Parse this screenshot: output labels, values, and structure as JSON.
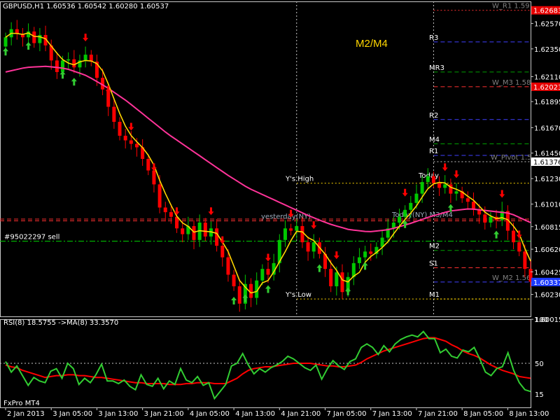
{
  "window": {
    "title_info": "GBPUSD,H1  1.60536  1.60542  1.60280  1.60537",
    "watermark": "FxPro MT4",
    "center_label": "M2/M4"
  },
  "colors": {
    "background": "#000000",
    "grid": "#c8c8c8",
    "bull": "#00c800",
    "bear": "#ff0000",
    "ma_fast": "#ffd700",
    "ma_slow": "#ff3399",
    "rsi": "#32cd32",
    "rsi_ma": "#ff0000",
    "arrow_up": "#32cd32",
    "arrow_down": "#ff0000",
    "current_price_box": "#1e3cff",
    "red_price_box": "#e60000"
  },
  "chart_data": [
    {
      "type": "candlestick",
      "symbol": "GBPUSD",
      "timeframe": "H1",
      "ylim": [
        1.6004,
        1.6276
      ],
      "price_ticks": [
        "1.62570",
        "1.62350",
        "1.62110",
        "1.61895",
        "1.61670",
        "1.61450",
        "1.61230",
        "1.61010",
        "1.60815",
        "1.60620",
        "1.60425",
        "1.60230",
        "1.60015"
      ],
      "price_tick_values": [
        1.6257,
        1.6235,
        1.6211,
        1.61895,
        1.6167,
        1.6145,
        1.6123,
        1.6101,
        1.60815,
        1.6062,
        1.60425,
        1.6023,
        1.60015
      ],
      "x_ticks": [
        "2 Jan 2013",
        "3 Jan 05:00",
        "3 Jan 13:00",
        "3 Jan 21:00",
        "4 Jan 05:00",
        "4 Jan 13:00",
        "4 Jan 21:00",
        "7 Jan 05:00",
        "7 Jan 13:00",
        "7 Jan 21:00",
        "8 Jan 05:00",
        "8 Jan 13:00"
      ],
      "x_tick_index": [
        0,
        8,
        16,
        24,
        32,
        40,
        48,
        56,
        64,
        72,
        80,
        88
      ],
      "bar_count": 93,
      "price_boxes": [
        {
          "label": "1.62683",
          "value": 1.62683,
          "color": "red"
        },
        {
          "label": "1.62023",
          "value": 1.62023,
          "color": "red"
        },
        {
          "label": "1.61376",
          "value": 1.61376,
          "color": "white"
        },
        {
          "label": "1.60337",
          "value": 1.60337,
          "color": "blue"
        }
      ],
      "levels": [
        {
          "name": "W_R1 1.59",
          "value": 1.62683,
          "style": "dotted",
          "color": "#ff3030",
          "side": "right"
        },
        {
          "name": "R3",
          "value": 1.6241,
          "style": "dashed",
          "color": "#4040ff",
          "side": "right"
        },
        {
          "name": "MR3",
          "value": 1.6215,
          "style": "dashed",
          "color": "#00a000",
          "side": "right"
        },
        {
          "name": "W_M3 1.58",
          "value": 1.62023,
          "style": "dashed",
          "color": "#ff3030",
          "side": "right"
        },
        {
          "name": "R2",
          "value": 1.6174,
          "style": "dashed",
          "color": "#4040ff",
          "side": "right"
        },
        {
          "name": "M4",
          "value": 1.6153,
          "style": "dashed",
          "color": "#00a000",
          "side": "right"
        },
        {
          "name": "R1",
          "value": 1.6143,
          "style": "dashed",
          "color": "#4040ff",
          "side": "right"
        },
        {
          "name": "W_Pivot 1.5",
          "value": 1.61376,
          "style": "dotted",
          "color": "#c8c8c8",
          "side": "right"
        },
        {
          "name": "Y's High",
          "value": 1.6119,
          "style": "dotted",
          "color": "#ffd700",
          "side": "mid"
        },
        {
          "name": "yesterday(NY)",
          "value": 1.60865,
          "style": "dashed",
          "color": "#ff3030",
          "side": "mid2"
        },
        {
          "name": "Today(NY) M3/M4",
          "value": 1.6088,
          "style": "dashed",
          "color": "#ff3030",
          "side": "mid3"
        },
        {
          "name": "#95022297 sell",
          "value": 1.6069,
          "style": "dashdot",
          "color": "#00cc00",
          "side": "left"
        },
        {
          "name": "M2",
          "value": 1.6061,
          "style": "dashed",
          "color": "#00a000",
          "side": "right"
        },
        {
          "name": "S1",
          "value": 1.6046,
          "style": "dashed",
          "color": "#ff3030",
          "side": "right"
        },
        {
          "name": "W_M2 1.56",
          "value": 1.60337,
          "style": "dashed",
          "color": "#4040ff",
          "side": "right"
        },
        {
          "name": "Y's Low",
          "value": 1.6019,
          "style": "dotted",
          "color": "#ffd700",
          "side": "mid"
        },
        {
          "name": "M1",
          "value": 1.6019,
          "style": "dotted",
          "color": "#ffd700",
          "side": "right"
        },
        {
          "name": "Today",
          "value": 1.6122,
          "style": "none",
          "color": "#ffffff",
          "side": "mid4"
        }
      ],
      "vertical_lines_index": [
        51,
        75
      ],
      "closes": [
        1.6245,
        1.6252,
        1.6248,
        1.6245,
        1.625,
        1.624,
        1.6247,
        1.6238,
        1.6225,
        1.6215,
        1.6225,
        1.6226,
        1.6219,
        1.6225,
        1.623,
        1.6224,
        1.621,
        1.62,
        1.6185,
        1.6172,
        1.616,
        1.6156,
        1.6153,
        1.615,
        1.614,
        1.613,
        1.6118,
        1.6098,
        1.6094,
        1.609,
        1.608,
        1.6075,
        1.6082,
        1.607,
        1.6085,
        1.6073,
        1.608,
        1.6065,
        1.6055,
        1.604,
        1.603,
        1.6015,
        1.6032,
        1.602,
        1.6035,
        1.6045,
        1.604,
        1.605,
        1.607,
        1.608,
        1.6078,
        1.6082,
        1.6068,
        1.606,
        1.6068,
        1.6058,
        1.6045,
        1.603,
        1.6042,
        1.6025,
        1.6038,
        1.605,
        1.6055,
        1.606,
        1.6058,
        1.6064,
        1.6072,
        1.608,
        1.6085,
        1.609,
        1.6096,
        1.6102,
        1.611,
        1.612,
        1.6125,
        1.6119,
        1.6115,
        1.6118,
        1.611,
        1.6112,
        1.6106,
        1.6103,
        1.6096,
        1.6092,
        1.6085,
        1.609,
        1.6087,
        1.6095,
        1.6078,
        1.6068,
        1.606,
        1.6045,
        1.6034
      ],
      "ma_fast_label": "yellow MA",
      "ma_slow_label": "magenta MA"
    },
    {
      "type": "line",
      "title": "RSI(8) 18.5755  ->MA(8) 33.3570",
      "ylim": [
        0,
        100
      ],
      "y_ticks": [
        "100",
        "50",
        "15"
      ],
      "y_tick_values": [
        100,
        50,
        15
      ],
      "series": [
        {
          "name": "RSI(8)",
          "values": [
            52,
            40,
            47,
            36,
            25,
            34,
            30,
            28,
            41,
            44,
            33,
            50,
            44,
            26,
            33,
            28,
            37,
            49,
            30,
            30,
            27,
            31,
            24,
            20,
            37,
            26,
            24,
            33,
            21,
            30,
            26,
            44,
            31,
            28,
            35,
            25,
            28,
            10,
            18,
            26,
            47,
            50,
            61,
            48,
            38,
            44,
            40,
            45,
            48,
            52,
            58,
            55,
            50,
            45,
            42,
            48,
            32,
            44,
            53,
            47,
            43,
            52,
            55,
            68,
            72,
            68,
            60,
            70,
            63,
            72,
            77,
            80,
            82,
            80,
            86,
            78,
            78,
            62,
            66,
            58,
            56,
            65,
            63,
            68,
            55,
            40,
            36,
            44,
            46,
            62,
            42,
            28,
            20,
            18
          ]
        },
        {
          "name": "MA(8)",
          "values": [
            48,
            46,
            45,
            42,
            40,
            38,
            36,
            34,
            35,
            36,
            36,
            37,
            37,
            36,
            36,
            35,
            34,
            34,
            33,
            32,
            31,
            30,
            29,
            28,
            28,
            27,
            27,
            27,
            27,
            26,
            26,
            26,
            27,
            27,
            28,
            28,
            28,
            27,
            27,
            27,
            30,
            33,
            38,
            42,
            44,
            45,
            46,
            46,
            47,
            48,
            49,
            50,
            50,
            50,
            50,
            49,
            48,
            47,
            47,
            46,
            46,
            47,
            48,
            51,
            55,
            58,
            61,
            64,
            66,
            68,
            70,
            72,
            74,
            76,
            78,
            79,
            79,
            77,
            75,
            71,
            68,
            64,
            61,
            59,
            56,
            52,
            48,
            45,
            42,
            40,
            38,
            35,
            34,
            33
          ]
        }
      ]
    }
  ]
}
